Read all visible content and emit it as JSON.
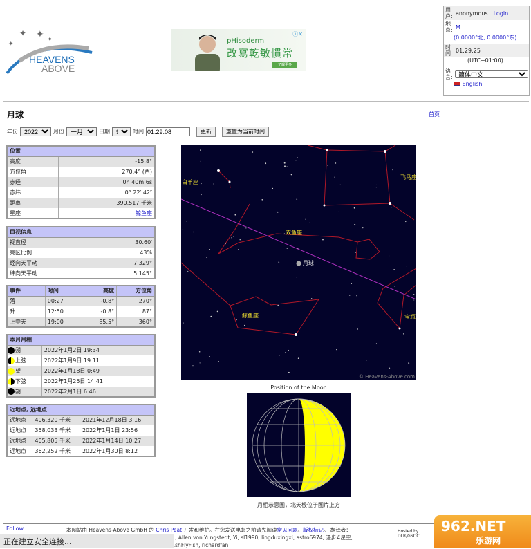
{
  "logo": {
    "line1": "HEAVENS",
    "line2": "ABOVE"
  },
  "ad": {
    "brand": "pHisoderm",
    "slogan": "改寫乾敏慣常",
    "cta": "了解更多",
    "close": "ⓘ✕"
  },
  "user": {
    "user_label": "用户:",
    "user": "anonymous",
    "login": "Login",
    "loc_label": "地点:",
    "loc": "M",
    "coords": "(0.0000°北, 0.0000°东)",
    "time_label": "时间:",
    "time": "01:29:25",
    "tz": "(UTC+01:00)",
    "lang_label": "语言:",
    "lang": "简体中文",
    "english": "English"
  },
  "page": {
    "title": "月球",
    "home": "首页"
  },
  "form": {
    "year_label": "年份",
    "year": "2022",
    "month_label": "月份",
    "month": "一月",
    "day_label": "日期",
    "day": "9",
    "time_label": "时间",
    "time": "01:29:08",
    "update": "更新",
    "reset": "重置为当前时间"
  },
  "position": {
    "header": "位置",
    "rows": [
      {
        "k": "高度",
        "v": "-15.8°"
      },
      {
        "k": "方位角",
        "v": "270.4° (西)"
      },
      {
        "k": "赤经",
        "v": "0h 40m 6s"
      },
      {
        "k": "赤纬",
        "v": "0° 22′ 42″"
      },
      {
        "k": "距离",
        "v": "390,517 千米"
      },
      {
        "k": "星座",
        "v": "鲸鱼座"
      }
    ]
  },
  "visual": {
    "header": "目视信息",
    "rows": [
      {
        "k": "视直径",
        "v": "30.60′"
      },
      {
        "k": "亮区比例",
        "v": "43%"
      },
      {
        "k": "经向天平动",
        "v": "7.329°"
      },
      {
        "k": "纬向天平动",
        "v": "5.145°"
      }
    ]
  },
  "events": {
    "headers": [
      "事件",
      "时间",
      "高度",
      "方位角"
    ],
    "rows": [
      [
        "落",
        "00:27",
        "-0.8°",
        "270°"
      ],
      [
        "升",
        "12:50",
        "-0.8°",
        "87°"
      ],
      [
        "上中天",
        "19:00",
        "85.5°",
        "360°"
      ]
    ]
  },
  "phases": {
    "header": "本月月相",
    "rows": [
      {
        "phase": "朔",
        "date": "2022年1月2日 19:34",
        "icon": "new"
      },
      {
        "phase": "上弦",
        "date": "2022年1月9日 19:11",
        "icon": "first"
      },
      {
        "phase": "望",
        "date": "2022年1月18日 0:49",
        "icon": "full"
      },
      {
        "phase": "下弦",
        "date": "2022年1月25日 14:41",
        "icon": "last"
      },
      {
        "phase": "朔",
        "date": "2022年2月1日 6:46",
        "icon": "new"
      }
    ]
  },
  "apsis": {
    "header": "近地点, 远地点",
    "rows": [
      [
        "远地点",
        "406,320 千米",
        "2021年12月18日 3:16"
      ],
      [
        "近地点",
        "358,033 千米",
        "2022年1月1日 23:56"
      ],
      [
        "远地点",
        "405,805 千米",
        "2022年1月14日 10:27"
      ],
      [
        "近地点",
        "362,252 千米",
        "2022年1月30日 8:12"
      ]
    ]
  },
  "map": {
    "labels": {
      "aries": "白羊座",
      "pegasus": "飞马座",
      "pisces": "双鱼座",
      "moon": "月球",
      "cetus": "鲸鱼座",
      "aquarius": "宝瓶座"
    },
    "copyright": "© Heavens-Above.com",
    "caption": "Position of the Moon"
  },
  "moon_caption": "月相示意图，北天极位于图片上方",
  "footer": {
    "follow": "Follow",
    "t1": "本网站由 Heavens-Above GmbH 的 ",
    "author": "Chris Peat",
    "t2": " 开发和维护。在您发送电邮之前请先阅读",
    "faq": "常见问题",
    "t3": "。",
    "legal": "版权标记",
    "t4": "。 翻译者：",
    "t5": "..., Allen von Yungstedt, Yi, sl1990, lingduxingxi, astro6974, 漫步#星空,",
    "t6": "...shFlyFish, richardfan",
    "hosted": "Hosted by",
    "dlr": "DLR/GSOC"
  },
  "status": "正在建立安全连接...",
  "watermark": {
    "num": "962.NET",
    "name": "乐游网"
  }
}
